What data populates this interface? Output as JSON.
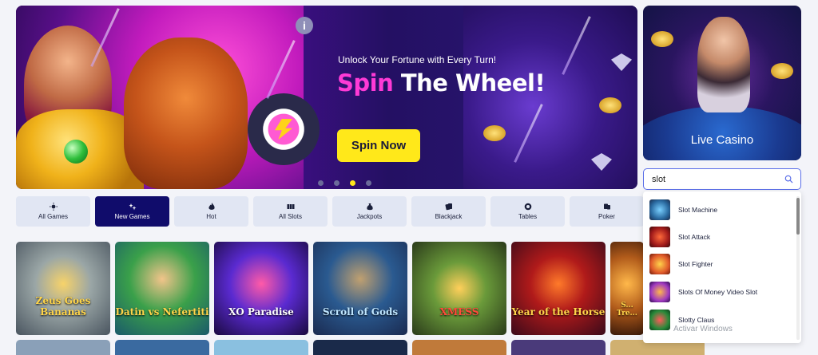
{
  "hero": {
    "subtitle": "Unlock Your Fortune with Every Turn!",
    "title_accent": "Spin",
    "title_rest": "The Wheel!",
    "cta": "Spin Now",
    "info": "i",
    "slide_count": 4,
    "active_slide": 3
  },
  "live_casino": {
    "label": "Live Casino"
  },
  "search": {
    "value": "slot"
  },
  "categories": [
    {
      "label": "All Games",
      "icon": "sun-icon",
      "active": false
    },
    {
      "label": "New Games",
      "icon": "sparkle-icon",
      "active": true
    },
    {
      "label": "Hot",
      "icon": "flame-icon",
      "active": false
    },
    {
      "label": "All Slots",
      "icon": "slots-icon",
      "active": false
    },
    {
      "label": "Jackpots",
      "icon": "money-bag-icon",
      "active": false
    },
    {
      "label": "Blackjack",
      "icon": "cards-icon",
      "active": false
    },
    {
      "label": "Tables",
      "icon": "chip-icon",
      "active": false
    },
    {
      "label": "Poker",
      "icon": "poker-icon",
      "active": false
    }
  ],
  "games": [
    {
      "title": "Zeus Goes Bananas"
    },
    {
      "title": "Datin vs Nefertiti"
    },
    {
      "title": "XO Paradise"
    },
    {
      "title": "Scroll of Gods"
    },
    {
      "title": "XMESS"
    },
    {
      "title": "Year of the Horse"
    },
    {
      "title": "S... Tre..."
    }
  ],
  "suggestions": [
    {
      "label": "Slot Machine"
    },
    {
      "label": "Slot Attack"
    },
    {
      "label": "Slot Fighter"
    },
    {
      "label": "Slots Of Money Video Slot"
    },
    {
      "label": "Slotty Claus"
    }
  ],
  "watermark": "Activar Windows",
  "colors": {
    "accent_pink": "#ff3ad6",
    "cta_yellow": "#ffe81a",
    "active_tab": "#100c6b"
  }
}
